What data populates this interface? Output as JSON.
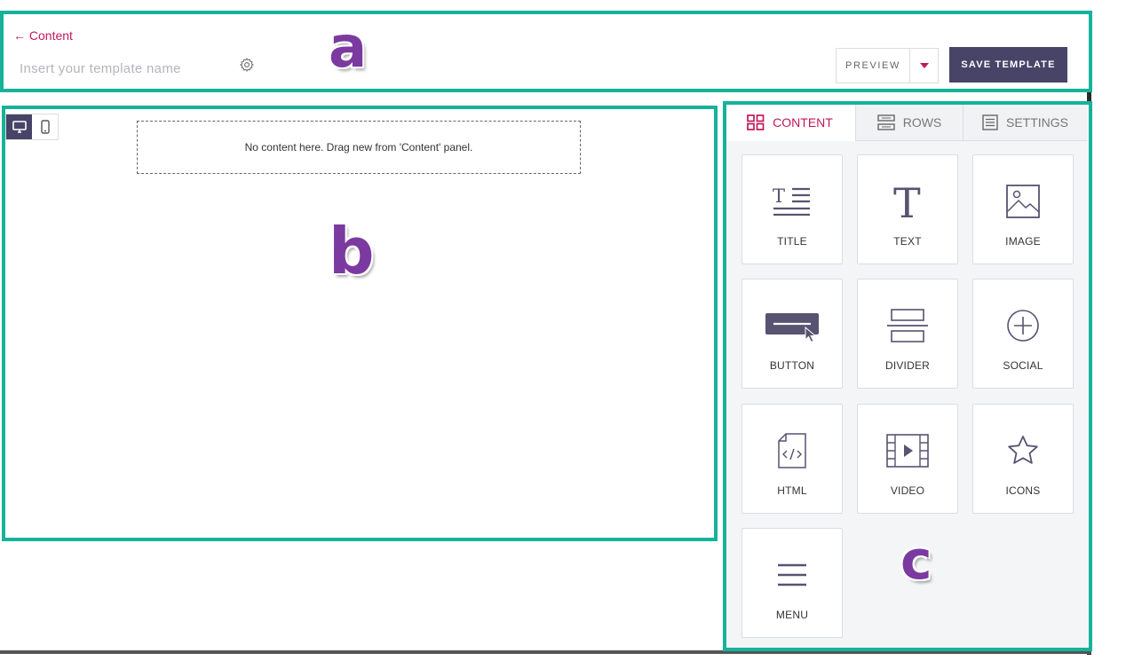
{
  "header": {
    "back_label": "← Content",
    "template_name_value": "",
    "template_name_placeholder": "Insert your template name",
    "preview_label": "PREVIEW",
    "save_label": "SAVE TEMPLATE"
  },
  "canvas": {
    "empty_message": "No content here. Drag new from 'Content' panel.",
    "view_modes": [
      "desktop",
      "mobile"
    ],
    "active_view": "desktop"
  },
  "panel": {
    "tabs": [
      {
        "label": "CONTENT",
        "icon": "grid-icon",
        "active": true
      },
      {
        "label": "ROWS",
        "icon": "rows-icon",
        "active": false
      },
      {
        "label": "SETTINGS",
        "icon": "settings-list-icon",
        "active": false
      }
    ],
    "blocks": [
      {
        "label": "TITLE",
        "icon": "title-icon"
      },
      {
        "label": "TEXT",
        "icon": "text-icon"
      },
      {
        "label": "IMAGE",
        "icon": "image-icon"
      },
      {
        "label": "BUTTON",
        "icon": "button-icon"
      },
      {
        "label": "DIVIDER",
        "icon": "divider-icon"
      },
      {
        "label": "SOCIAL",
        "icon": "social-icon"
      },
      {
        "label": "HTML",
        "icon": "html-icon"
      },
      {
        "label": "VIDEO",
        "icon": "video-icon"
      },
      {
        "label": "ICONS",
        "icon": "star-icon"
      },
      {
        "label": "MENU",
        "icon": "menu-icon"
      }
    ]
  },
  "annotations": {
    "a": "a",
    "b": "b",
    "c": "c"
  },
  "colors": {
    "accent": "#c2185b",
    "primary_button": "#484468",
    "highlight": "#16b29a",
    "annotation_letter": "#7b3aa0",
    "panel_bg": "#f4f5f7",
    "icon": "#575370"
  }
}
